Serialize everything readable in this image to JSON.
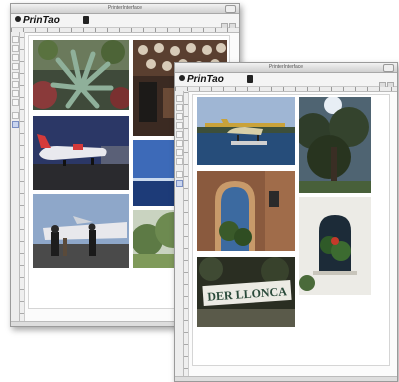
{
  "app": {
    "logo_text": "PrinTao",
    "window_title": "PrinterInterface"
  },
  "back_window": {
    "title": "PrinterInterface",
    "photos": [
      "agave-plant-photo",
      "shelves-of-plates-photo",
      "airliner-on-tarmac-photo",
      "sea-horizon-photo",
      "airport-passengers-photo",
      "garden-trees-photo"
    ]
  },
  "front_window": {
    "title": "PrinterInterface",
    "photos": [
      "seaplane-on-water-photo",
      "tree-against-sky-photo",
      "stone-archway-photo",
      "window-with-plants-photo",
      "street-sign-photo"
    ],
    "sign_text": "DER LLONCA"
  },
  "colors": {
    "close": "#e94b3c",
    "minimize": "#f5b928",
    "maximize": "#5bbf3a",
    "selected_tool": "#c9d5ef"
  }
}
